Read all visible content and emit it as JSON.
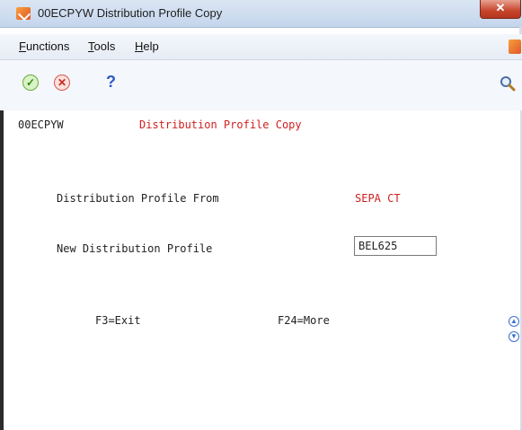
{
  "window": {
    "title": "00ECPYW  Distribution Profile Copy",
    "close_label": "✕"
  },
  "menu": {
    "items": [
      {
        "label": "Functions",
        "accel": "F",
        "rest": "unctions"
      },
      {
        "label": "Tools",
        "accel": "T",
        "rest": "ools"
      },
      {
        "label": "Help",
        "accel": "H",
        "rest": "elp"
      }
    ]
  },
  "toolbar": {
    "ok_symbol": "✓",
    "cancel_symbol": "✕",
    "help_symbol": "?"
  },
  "form": {
    "program_id": "00ECPYW",
    "title": "Distribution Profile Copy",
    "from_label": "Distribution Profile From",
    "from_value": "SEPA CT",
    "new_label": "New Distribution Profile",
    "new_value": "BEL625",
    "f3_label": "F3=Exit",
    "f24_label": "F24=More"
  },
  "colors": {
    "accent_red": "#d11f1f",
    "titlebar": "#c4d5ec"
  },
  "icons": [
    "app-icon",
    "ok-icon",
    "cancel-icon",
    "help-icon",
    "search-icon",
    "scroll-up-icon",
    "scroll-down-icon"
  ]
}
